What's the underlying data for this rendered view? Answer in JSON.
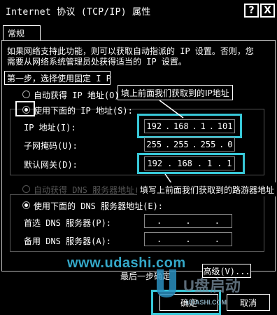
{
  "window": {
    "title": "Internet 协议 (TCP/IP) 属性",
    "help_label": "?",
    "close_label": "X"
  },
  "tab": {
    "label": "常规"
  },
  "intro": "如果网络支持此功能，则可以获取自动指派的 IP 设置。否则，您需要从网络系统管理员处获得适当的 IP 设置。",
  "step1": "第一步，选择使用固定 I P",
  "ip": {
    "auto_label": "自动获得 IP 地址(O)",
    "manual_label": "使用下面的 IP 地址(S):",
    "ip_label": "IP 地址(I):",
    "ip": [
      "192",
      "168",
      "1",
      "101"
    ],
    "mask_label": "子网掩码(U):",
    "mask": [
      "255",
      "255",
      "255",
      "0"
    ],
    "gateway_label": "默认网关(D):",
    "gateway": [
      "192",
      "168",
      "1",
      "1"
    ]
  },
  "dns": {
    "auto_label": "自动获得 DNS 服务器地址(B)",
    "manual_label": "使用下面的 DNS 服务器地址(E):",
    "preferred_label": "首选 DNS 服务器(P):",
    "alternate_label": "备用 DNS 服务器(A):"
  },
  "callouts": {
    "ip": "填上前面我们获取到的IP地址",
    "gateway": "填写上前面我们获取到的路游器地址"
  },
  "watermark": "www.udashi.com",
  "final_step": "最后一步确定",
  "buttons": {
    "advanced": "高级(V)...",
    "ok": "确定",
    "cancel": "取消"
  },
  "logo": {
    "text": "U盘启动",
    "url": "UDASHI.COM"
  },
  "colors": {
    "highlight": "#38c8d8",
    "background": "#000000"
  }
}
